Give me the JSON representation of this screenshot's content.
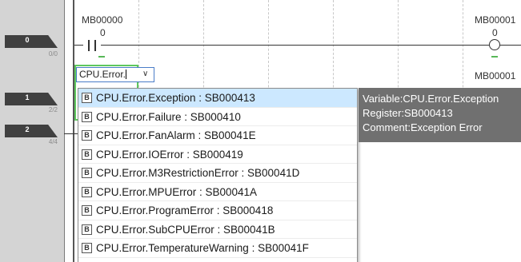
{
  "rungs": [
    {
      "number": "0",
      "step": "0/0"
    },
    {
      "number": "1",
      "step": "2/2"
    },
    {
      "number": "2",
      "step": "4/4"
    }
  ],
  "row0": {
    "contact_label": "MB00000",
    "contact_value": "0",
    "coil_label": "MB00001",
    "coil_value": "0"
  },
  "row1": {
    "coil_label": "MB00001"
  },
  "editor": {
    "input_value": "CPU.Error.",
    "chevron": "∨"
  },
  "autocomplete": {
    "badge_glyph": "B",
    "items": [
      "CPU.Error.Exception : SB000413",
      "CPU.Error.Failure : SB000410",
      "CPU.Error.FanAlarm : SB00041E",
      "CPU.Error.IOError : SB000419",
      "CPU.Error.M3RestrictionError : SB00041D",
      "CPU.Error.MPUError : SB00041A",
      "CPU.Error.ProgramError : SB000418",
      "CPU.Error.SubCPUError : SB00041B",
      "CPU.Error.TemperatureWarning : SB00041F"
    ],
    "selected_index": 0
  },
  "tooltip": {
    "variable": "Variable:CPU.Error.Exception",
    "register": "Register:SB000413",
    "comment": "Comment:Exception Error"
  },
  "colors": {
    "gutter": "#d4d4d4",
    "rung_tag": "#404040",
    "edit_border": "#5ec85e",
    "selected_row": "#cce8ff",
    "tooltip_bg": "#707070"
  }
}
